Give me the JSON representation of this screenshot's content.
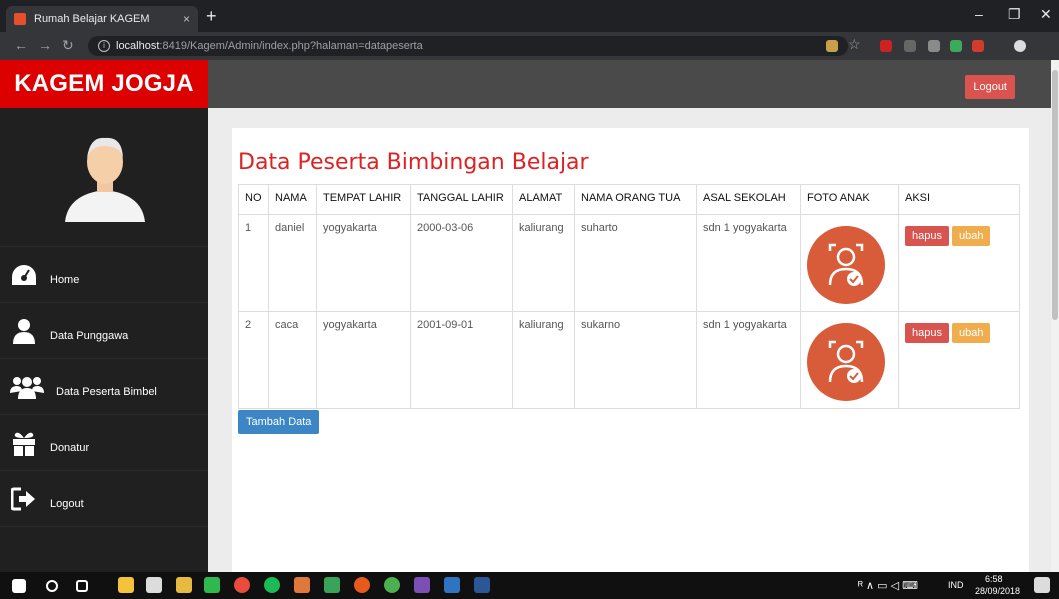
{
  "browser": {
    "tab_title": "Rumah Belajar KAGEM",
    "tab_close": "×",
    "new_tab": "+",
    "url_host": "localhost",
    "url_path": ":8419/Kagem/Admin/index.php?halaman=datapeserta",
    "win_min": "–",
    "win_max": "❐",
    "win_close": "✕"
  },
  "sidebar": {
    "brand": "KAGEM JOGJA",
    "items": [
      {
        "label": "Home",
        "icon": "dashboard-icon"
      },
      {
        "label": "Data Punggawa",
        "icon": "user-icon"
      },
      {
        "label": "Data Peserta Bimbel",
        "icon": "users-icon"
      },
      {
        "label": "Donatur",
        "icon": "gift-icon"
      },
      {
        "label": "Logout",
        "icon": "sign-out-icon"
      }
    ]
  },
  "topbar": {
    "logout_label": "Logout"
  },
  "main": {
    "title": "Data Peserta Bimbingan Belajar",
    "columns": [
      "NO",
      "NAMA",
      "TEMPAT LAHIR",
      "TANGGAL LAHIR",
      "ALAMAT",
      "NAMA ORANG TUA",
      "ASAL SEKOLAH",
      "FOTO ANAK",
      "AKSI"
    ],
    "rows": [
      {
        "no": "1",
        "nama": "daniel",
        "tempat_lahir": "yogyakarta",
        "tanggal_lahir": "2000-03-06",
        "alamat": "kaliurang",
        "nama_ortu": "suharto",
        "asal_sekolah": "sdn 1 yogyakarta"
      },
      {
        "no": "2",
        "nama": "caca",
        "tempat_lahir": "yogyakarta",
        "tanggal_lahir": "2001-09-01",
        "alamat": "kaliurang",
        "nama_ortu": "sukarno",
        "asal_sekolah": "sdn 1 yogyakarta"
      }
    ],
    "delete_label": "hapus",
    "edit_label": "ubah",
    "add_label": "Tambah Data"
  },
  "taskbar": {
    "language": "IND",
    "time": "6:58",
    "date": "28/09/2018"
  },
  "colors": {
    "brand_red": "#dd0000",
    "sidebar_bg": "#202020",
    "topbar_bg": "#4a4a4a",
    "title_red": "#dd2222",
    "danger": "#d9534f",
    "warning": "#f0ad4e",
    "primary": "#3c86c6",
    "photo_orange": "#d85c3a"
  }
}
